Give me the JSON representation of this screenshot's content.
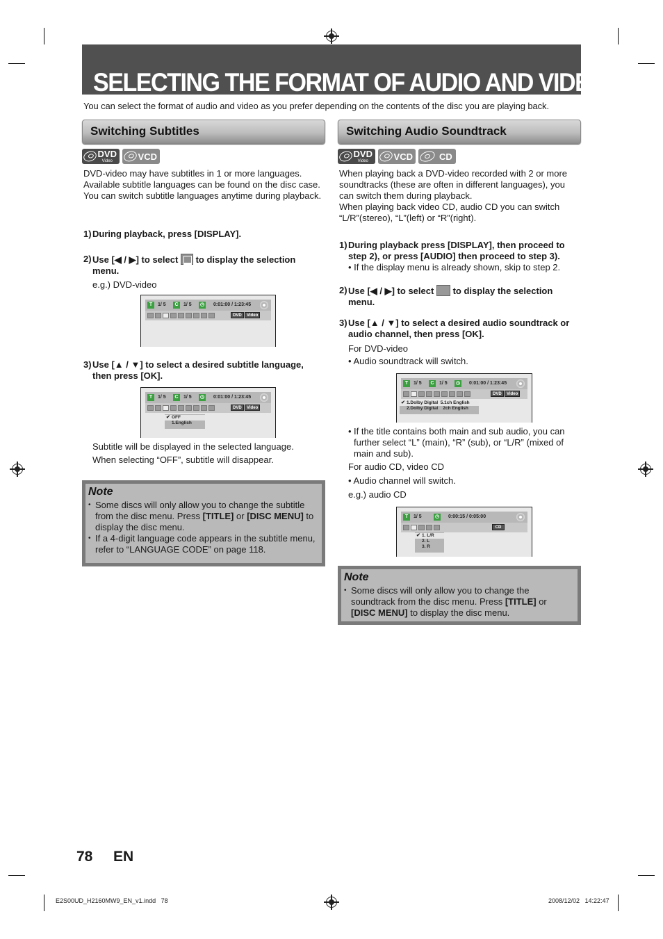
{
  "header": {
    "title": "SELECTING THE FORMAT OF AUDIO AND VIDEO",
    "intro": "You can select the format of audio and video as you prefer depending on the contents of the disc you are playing back."
  },
  "subtitles": {
    "heading": "Switching Subtitles",
    "badges": [
      {
        "label": "DVD",
        "sub": "Video",
        "icon": "dvd-video-disc-icon"
      },
      {
        "label": "VCD",
        "sub": "",
        "icon": "vcd-disc-icon"
      }
    ],
    "description": "DVD-video may have subtitles in 1 or more languages. Available subtitle languages can be found on the disc case. You can switch subtitle languages anytime during playback.",
    "steps": [
      {
        "num": "1)",
        "text": "During playback, press [DISPLAY]."
      },
      {
        "num": "2)",
        "text_before": "Use [◀ / ▶] to select",
        "text_after": "to display the selection menu.",
        "example": "e.g.) DVD-video"
      },
      {
        "num": "3)",
        "text": "Use [▲ / ▼] to select a desired subtitle language, then press [OK]."
      }
    ],
    "result_lines": [
      "Subtitle will be displayed in the selected language.",
      "When selecting “OFF”, subtitle will disappear."
    ],
    "screen1": {
      "title": "1/  5",
      "chapter": "1/  5",
      "time": "0:01:00 / 1:23:45",
      "tag1": "DVD",
      "tag2": "Video"
    },
    "screen2": {
      "title": "1/  5",
      "chapter": "1/  5",
      "time": "0:01:00 / 1:23:45",
      "tag1": "DVD",
      "tag2": "Video",
      "menu": [
        "OFF",
        "1.English"
      ],
      "selected_index": 0
    },
    "note": {
      "heading": "Note",
      "items": [
        {
          "pre": "Some discs will only allow you to change the subtitle from the disc menu. Press ",
          "b1": "[TITLE]",
          "mid": " or ",
          "b2": "[DISC MENU]",
          "post": " to display the disc menu."
        },
        {
          "pre": "If a 4-digit language code appears in the subtitle menu, refer to “LANGUAGE CODE” on page 118."
        }
      ]
    }
  },
  "audio": {
    "heading": "Switching Audio Soundtrack",
    "badges": [
      {
        "label": "DVD",
        "sub": "Video",
        "icon": "dvd-video-disc-icon"
      },
      {
        "label": "VCD",
        "sub": "",
        "icon": "vcd-disc-icon"
      },
      {
        "label": "CD",
        "sub": "",
        "icon": "cd-disc-icon"
      }
    ],
    "description": "When playing back a DVD-video recorded with 2 or more soundtracks (these are often in different languages), you can switch them during playback.\nWhen playing back video CD, audio CD you can switch “L/R”(stereo), “L”(left) or “R”(right).",
    "steps": [
      {
        "num": "1)",
        "text": "During playback press [DISPLAY], then proceed to step 2), or press [AUDIO] then proceed to step 3).",
        "bullet": "• If the display menu is already shown, skip to step 2."
      },
      {
        "num": "2)",
        "text_before": "Use [◀ / ▶] to select",
        "text_after": "to display the selection menu."
      },
      {
        "num": "3)",
        "text": "Use [▲ / ▼] to select a desired audio soundtrack or audio channel, then press [OK]."
      }
    ],
    "for_dvd": "For DVD-video",
    "dvd_bullet": "• Audio soundtrack will switch.",
    "main_sub_bullet": "If the title contains both main and sub audio, you can further select “L” (main), “R” (sub), or “L/R” (mixed of main and sub).",
    "for_cd": "For audio CD, video CD",
    "cd_bullet": "• Audio channel will switch.",
    "cd_example": "e.g.) audio CD",
    "screen1": {
      "title": "1/  5",
      "chapter": "1/  5",
      "time": "0:01:00 / 1:23:45",
      "tag1": "DVD",
      "tag2": "Video",
      "menu": [
        "1.Dolby Digital  5.1ch English",
        "2.Dolby Digital    2ch English"
      ],
      "selected_index": 0
    },
    "screen2": {
      "track": "1/  5",
      "time": "0:00:15 / 0:05:00",
      "tag1": "CD",
      "menu": [
        "1. L/R",
        "2. L",
        "3. R"
      ],
      "selected_index": 0
    },
    "note": {
      "heading": "Note",
      "items": [
        {
          "pre": "Some discs will only allow you to change the soundtrack from the disc menu. Press ",
          "b1": "[TITLE]",
          "mid": " or ",
          "b2": "[DISC MENU]",
          "post": " to display the disc menu."
        }
      ]
    }
  },
  "footer": {
    "page_number": "78",
    "language": "EN",
    "file": "E2S00UD_H2160MW9_EN_v1.indd   78",
    "timestamp": "2008/12/02   14:22:47"
  }
}
